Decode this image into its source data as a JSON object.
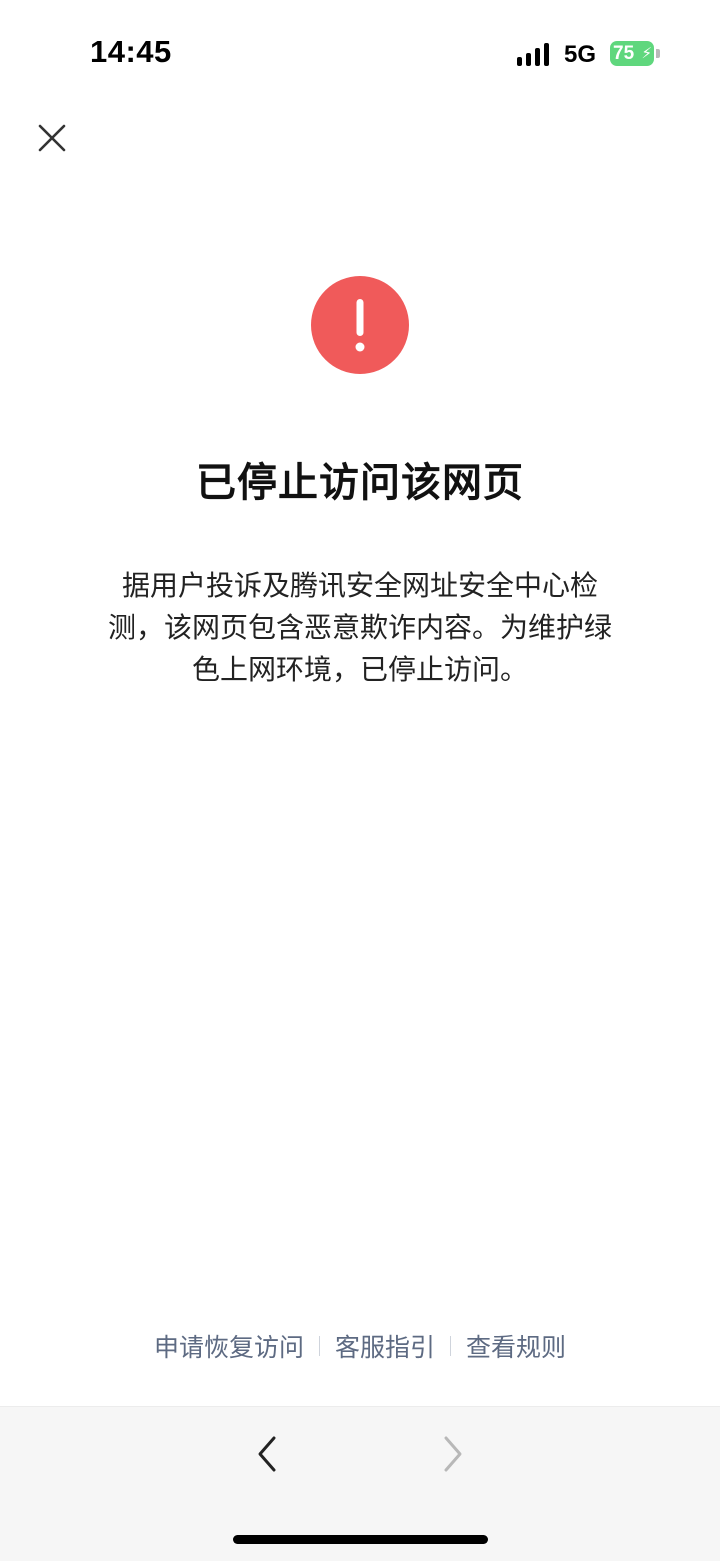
{
  "status_bar": {
    "time": "14:45",
    "network": "5G",
    "battery": "75"
  },
  "header": {
    "close_icon": "close-icon"
  },
  "warning": {
    "icon": "exclamation-icon",
    "color": "#f05a5a"
  },
  "page_title": "已停止访问该网页",
  "description": [
    "据用户投诉及腾讯安全网址安全中心检",
    "测，该网页包含恶意欺诈内容。为维护绿",
    "色上网环境，已停止访问。"
  ],
  "footer_links": [
    "申请恢复访问",
    "客服指引",
    "查看规则"
  ],
  "nav_bar": {
    "back_icon": "chevron-left-icon",
    "forward_icon": "chevron-right-icon"
  }
}
